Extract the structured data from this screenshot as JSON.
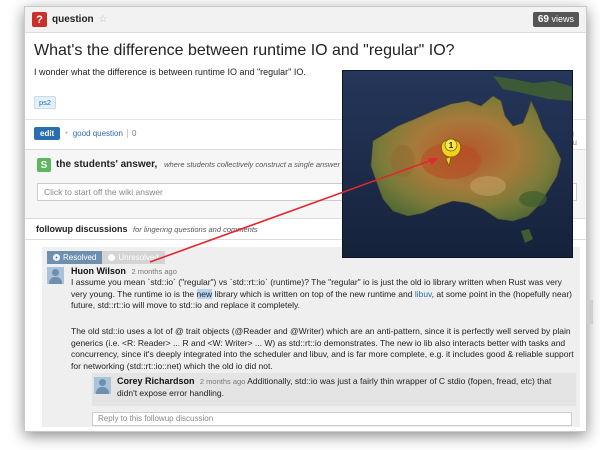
{
  "header": {
    "label": "question",
    "views_count": "69",
    "views_label": "views"
  },
  "question": {
    "title": "What's the difference between runtime IO and \"regular\" IO?",
    "body": "I wonder what the difference is between runtime IO and \"regular\" IO.",
    "tag": "ps2",
    "edit_label": "edit",
    "good_question_label": "good question",
    "good_question_count": "0",
    "author_partial": "ng Niu"
  },
  "students_answer": {
    "icon_letter": "S",
    "heading": "the students' answer,",
    "subheading": "where students collectively construct a single answer",
    "placeholder": "Click to start off the wiki answer"
  },
  "followups": {
    "heading": "followup discussions",
    "subheading": "for lingering questions and comments",
    "resolved_label": "Resolved",
    "unresolved_label": "Unresolved",
    "post": {
      "author": "Huon Wilson",
      "time": "2 months ago",
      "p1_a": "I assume you mean `std::io` (\"regular\") vs `std::rt::io` (runtime)? The \"regular\" io is just the old io library written when Rust was very very young. The runtime io is the ",
      "p1_new": "new",
      "p1_b": " library which is written on top of the new runtime and ",
      "p1_link": "libuv",
      "p1_c": ", at some point in the (hopefully near) future, std::rt::io will move to std::io and replace it completely.",
      "p2": "The old std::io uses a lot of @ trait objects (@Reader and @Writer) which are an anti-pattern, since it is perfectly well served by plain generics (i.e. <R: Reader> ... R and <W: Writer> ... W) as std::rt::io demonstrates. The new io lib also interacts better with tasks and concurrency, since it's deeply integrated into the scheduler and libuv, and is far more complete, e.g. it includes good & reliable support for networking (std::rt::io::net) which the old io did not."
    },
    "reply": {
      "author": "Corey Richardson",
      "time": "2 months ago",
      "text": "Additionally, std::io was just a fairly thin wrapper of C stdio (fopen, fread, etc) that didn't expose error handling."
    },
    "reply_placeholder": "Reply to this followup discussion"
  },
  "map_overlay": {
    "marker_label": "1"
  },
  "colors": {
    "accent": "#2a6db0",
    "question_icon": "#c9302c",
    "students_icon": "#5cb85c",
    "arrow": "#e0282e"
  }
}
